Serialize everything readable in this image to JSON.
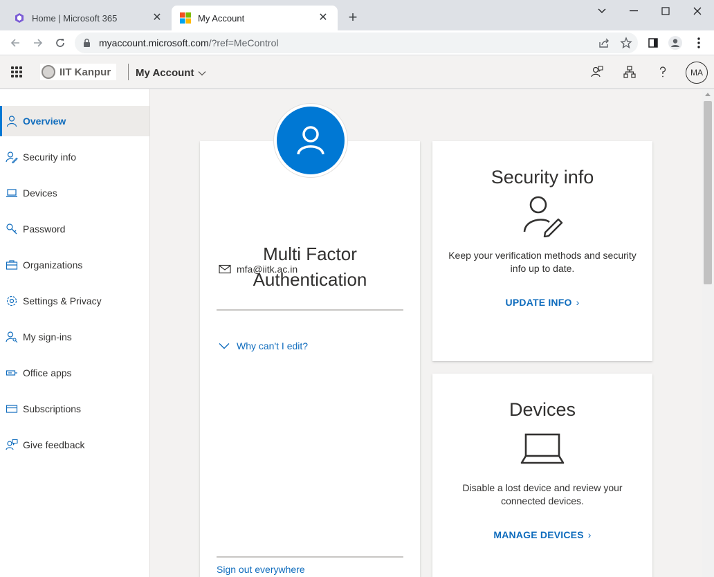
{
  "browser": {
    "tabs": [
      {
        "title": "Home | Microsoft 365",
        "active": false
      },
      {
        "title": "My Account",
        "active": true
      }
    ],
    "new_tab_label": "+",
    "url_host": "myaccount.microsoft.com",
    "url_rest": "/?ref=MeControl"
  },
  "header": {
    "org_name": "IIT Kanpur",
    "app_name": "My Account",
    "avatar_initials": "MA"
  },
  "sidebar": {
    "items": [
      {
        "label": "Overview",
        "icon": "person-icon",
        "selected": true
      },
      {
        "label": "Security info",
        "icon": "person-edit-icon"
      },
      {
        "label": "Devices",
        "icon": "laptop-icon"
      },
      {
        "label": "Password",
        "icon": "key-icon"
      },
      {
        "label": "Organizations",
        "icon": "briefcase-icon"
      },
      {
        "label": "Settings & Privacy",
        "icon": "gear-icon"
      },
      {
        "label": "My sign-ins",
        "icon": "person-key-icon"
      },
      {
        "label": "Office apps",
        "icon": "apps-icon"
      },
      {
        "label": "Subscriptions",
        "icon": "card-icon"
      },
      {
        "label": "Give feedback",
        "icon": "feedback-icon"
      }
    ]
  },
  "profile": {
    "name_line1": "Multi Factor",
    "name_line2": "Authentication",
    "email": "mfa@iitk.ac.in",
    "why_cant_edit": "Why can't I edit?",
    "sign_out": "Sign out everywhere"
  },
  "cards": {
    "security": {
      "title": "Security info",
      "description": "Keep your verification methods and security info up to date.",
      "link": "UPDATE INFO"
    },
    "devices": {
      "title": "Devices",
      "description": "Disable a lost device and review your connected devices.",
      "link": "MANAGE DEVICES"
    }
  },
  "colors": {
    "accent": "#0078d4",
    "link": "#0f6cbd"
  }
}
